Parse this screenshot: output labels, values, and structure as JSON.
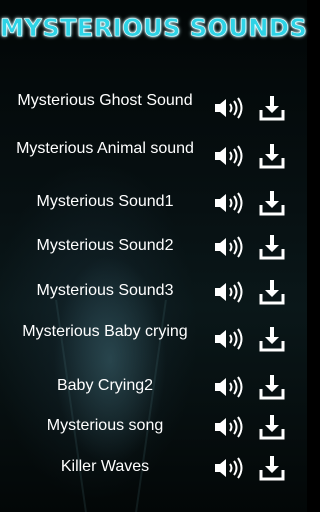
{
  "app": {
    "title": "MYSTERIOUS SOUNDS"
  },
  "colors": {
    "title": "#2ed3e6",
    "text": "#ffffff",
    "icons": "#ffffff"
  },
  "sounds": [
    {
      "label": "Mysterious Ghost Sound",
      "play_icon": "speaker-icon",
      "download_icon": "download-icon"
    },
    {
      "label": "Mysterious Animal sound",
      "play_icon": "speaker-icon",
      "download_icon": "download-icon"
    },
    {
      "label": "Mysterious Sound1",
      "play_icon": "speaker-icon",
      "download_icon": "download-icon"
    },
    {
      "label": "Mysterious Sound2",
      "play_icon": "speaker-icon",
      "download_icon": "download-icon"
    },
    {
      "label": "Mysterious Sound3",
      "play_icon": "speaker-icon",
      "download_icon": "download-icon"
    },
    {
      "label": "Mysterious Baby crying",
      "play_icon": "speaker-icon",
      "download_icon": "download-icon"
    },
    {
      "label": "Baby Crying2",
      "play_icon": "speaker-icon",
      "download_icon": "download-icon"
    },
    {
      "label": "Mysterious song",
      "play_icon": "speaker-icon",
      "download_icon": "download-icon"
    },
    {
      "label": "Killer Waves",
      "play_icon": "speaker-icon",
      "download_icon": "download-icon"
    }
  ]
}
